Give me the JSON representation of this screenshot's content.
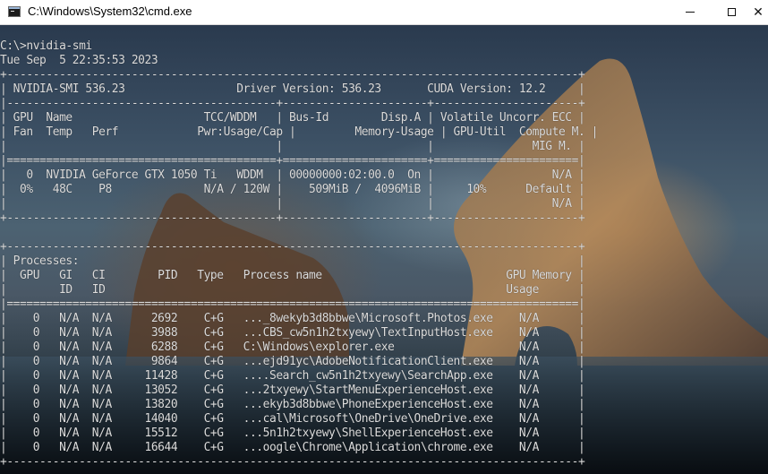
{
  "window": {
    "title": "C:\\Windows\\System32\\cmd.exe",
    "minimize_glyph": "—",
    "maximize_glyph": "☐",
    "close_glyph": "✕",
    "icon": "console-icon"
  },
  "terminal": {
    "lines": [
      "C:\\>nvidia-smi",
      "Tue Sep  5 22:35:53 2023",
      "+---------------------------------------------------------------------------------------+",
      "| NVIDIA-SMI 536.23                 Driver Version: 536.23       CUDA Version: 12.2     |",
      "|-----------------------------------------+----------------------+----------------------+",
      "| GPU  Name                    TCC/WDDM   | Bus-Id        Disp.A | Volatile Uncorr. ECC |",
      "| Fan  Temp   Perf            Pwr:Usage/Cap |         Memory-Usage | GPU-Util  Compute M. |",
      "|                                         |                      |               MIG M. |",
      "|=========================================+======================+======================|",
      "|   0  NVIDIA GeForce GTX 1050 Ti   WDDM  | 00000000:02:00.0  On |                  N/A |",
      "|  0%   48C    P8              N/A / 120W |    509MiB /  4096MiB |     10%      Default |",
      "|                                         |                      |                  N/A |",
      "+-----------------------------------------+----------------------+----------------------+",
      "",
      "+---------------------------------------------------------------------------------------+",
      "| Processes:                                                                            |",
      "|  GPU   GI   CI        PID   Type   Process name                            GPU Memory |",
      "|        ID   ID                                                             Usage      |",
      "|=======================================================================================|",
      "|    0   N/A  N/A      2692    C+G   ..._8wekyb3d8bbwe\\Microsoft.Photos.exe    N/A      |",
      "|    0   N/A  N/A      3988    C+G   ...CBS_cw5n1h2txyewy\\TextInputHost.exe    N/A      |",
      "|    0   N/A  N/A      6288    C+G   C:\\Windows\\explorer.exe                   N/A      |",
      "|    0   N/A  N/A      9864    C+G   ...ejd91yc\\AdobeNotificationClient.exe    N/A      |",
      "|    0   N/A  N/A     11428    C+G   ....Search_cw5n1h2txyewy\\SearchApp.exe    N/A      |",
      "|    0   N/A  N/A     13052    C+G   ...2txyewy\\StartMenuExperienceHost.exe    N/A      |",
      "|    0   N/A  N/A     13820    C+G   ...ekyb3d8bbwe\\PhoneExperienceHost.exe    N/A      |",
      "|    0   N/A  N/A     14040    C+G   ...cal\\Microsoft\\OneDrive\\OneDrive.exe    N/A      |",
      "|    0   N/A  N/A     15512    C+G   ...5n1h2txyewy\\ShellExperienceHost.exe    N/A      |",
      "|    0   N/A  N/A     16644    C+G   ...oogle\\Chrome\\Application\\chrome.exe    N/A      |",
      "+---------------------------------------------------------------------------------------+"
    ]
  },
  "colors": {
    "titlebar_bg": "#ffffff",
    "console_text": "#dcdcdc"
  }
}
